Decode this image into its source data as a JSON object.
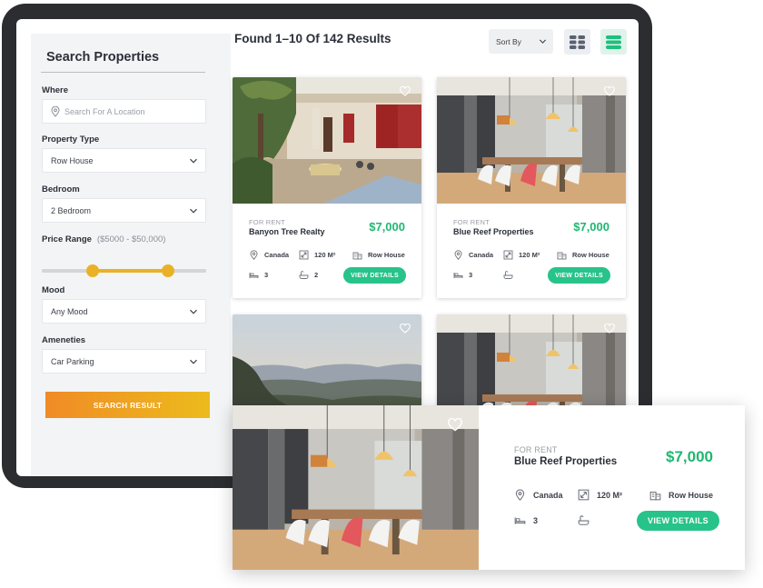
{
  "sidebar": {
    "title": "Search Properties",
    "where": {
      "label": "Where",
      "placeholder": "Search For A Location"
    },
    "property_type": {
      "label": "Property Type",
      "value": "Row House"
    },
    "bedroom": {
      "label": "Bedroom",
      "value": "2 Bedroom"
    },
    "price_range": {
      "label": "Price Range",
      "range_text": "($5000 - $50,000)",
      "min_fraction": 0.31,
      "max_fraction": 0.77
    },
    "mood": {
      "label": "Mood",
      "value": "Any Mood"
    },
    "ameneties": {
      "label": "Ameneties",
      "value": "Car Parking"
    },
    "search_button": "SEARCH RESULT"
  },
  "header": {
    "results_title": "Found 1–10 Of 142 Results",
    "sort_label": "Sort By",
    "active_view": "list"
  },
  "listings": [
    {
      "kind": "FOR RENT",
      "name": "Banyon Tree Realty",
      "price": "$7,000",
      "location": "Canada",
      "area": "120 M²",
      "type": "Row House",
      "beds": "3",
      "baths": "2",
      "button": "VIEW DETAILS",
      "photo": "courtyard"
    },
    {
      "kind": "FOR RENT",
      "name": "Blue Reef Properties",
      "price": "$7,000",
      "location": "Canada",
      "area": "120 M²",
      "type": "Row House",
      "beds": "3",
      "baths": "",
      "button": "VIEW DETAILS",
      "photo": "dining-room"
    },
    {
      "photo": "mountain-view"
    },
    {
      "photo": "dining-room"
    }
  ],
  "featured": {
    "kind": "FOR RENT",
    "name": "Blue Reef Properties",
    "price": "$7,000",
    "location": "Canada",
    "area": "120 M²",
    "type": "Row House",
    "beds": "3",
    "baths": "",
    "button": "VIEW DETAILS",
    "photo": "dining-room"
  },
  "colors": {
    "accent_green": "#27c38a",
    "price_green": "#1fb771",
    "slider": "#e9b226",
    "button_gradient": [
      "#f08b26",
      "#ecbb1c"
    ],
    "device_frame": "#2b2d31"
  }
}
